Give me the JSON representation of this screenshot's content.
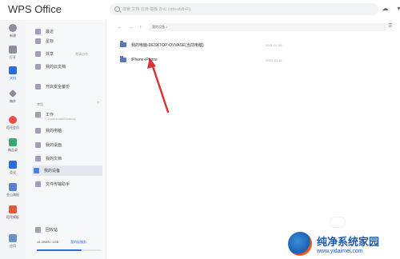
{
  "app": {
    "title": "WPS Office"
  },
  "search": {
    "placeholder": "搜索 文档 应用 模板 办公 (ctrl+shift+F)"
  },
  "leftrail": {
    "items": [
      {
        "label": "新建"
      },
      {
        "label": "打开"
      },
      {
        "label": "文档"
      },
      {
        "label": "稿件"
      },
      {
        "label": "稻壳会员"
      },
      {
        "label": "稿品录"
      },
      {
        "label": "会议"
      },
      {
        "label": "金山海报"
      },
      {
        "label": "稻壳模板"
      },
      {
        "label": "应用"
      }
    ]
  },
  "sidepanel": {
    "items": [
      {
        "label": "最近",
        "meta": ""
      },
      {
        "label": "星标",
        "meta": ""
      },
      {
        "label": "共享",
        "meta": "邀请协作"
      },
      {
        "label": "我的云文档",
        "meta": ""
      },
      {
        "label": "开启安全备份",
        "meta": ""
      }
    ],
    "section_label": "常用",
    "section_plus": "+",
    "pinned": [
      {
        "label": "工作",
        "sub": "C:\\Users\\nas\\Desktop"
      },
      {
        "label": "我的电脑"
      },
      {
        "label": "我的桌面"
      },
      {
        "label": "我的文档"
      },
      {
        "label": "我的设备"
      },
      {
        "label": "文件传输助手"
      }
    ],
    "recycle": "回收站",
    "storage": {
      "used": "46.35MB / 1GB",
      "link": "我的云服务",
      "fraction": 0.7
    }
  },
  "nav": {
    "back": "←",
    "forward": "→",
    "up": "↑",
    "breadcrumb": "我的设备  >"
  },
  "files": [
    {
      "name": "我的电脑-DESKTOP-OVVASE(当前电脑)",
      "date": "2021-01-29"
    },
    {
      "name": "iPhone-iPhone",
      "date": "2019-10-18"
    }
  ],
  "watermark": {
    "title": "纯净系统家园",
    "url": "www.yidaimei.com"
  },
  "colors": {
    "accent": "#2c6bdd",
    "arrow": "#d9333a"
  }
}
